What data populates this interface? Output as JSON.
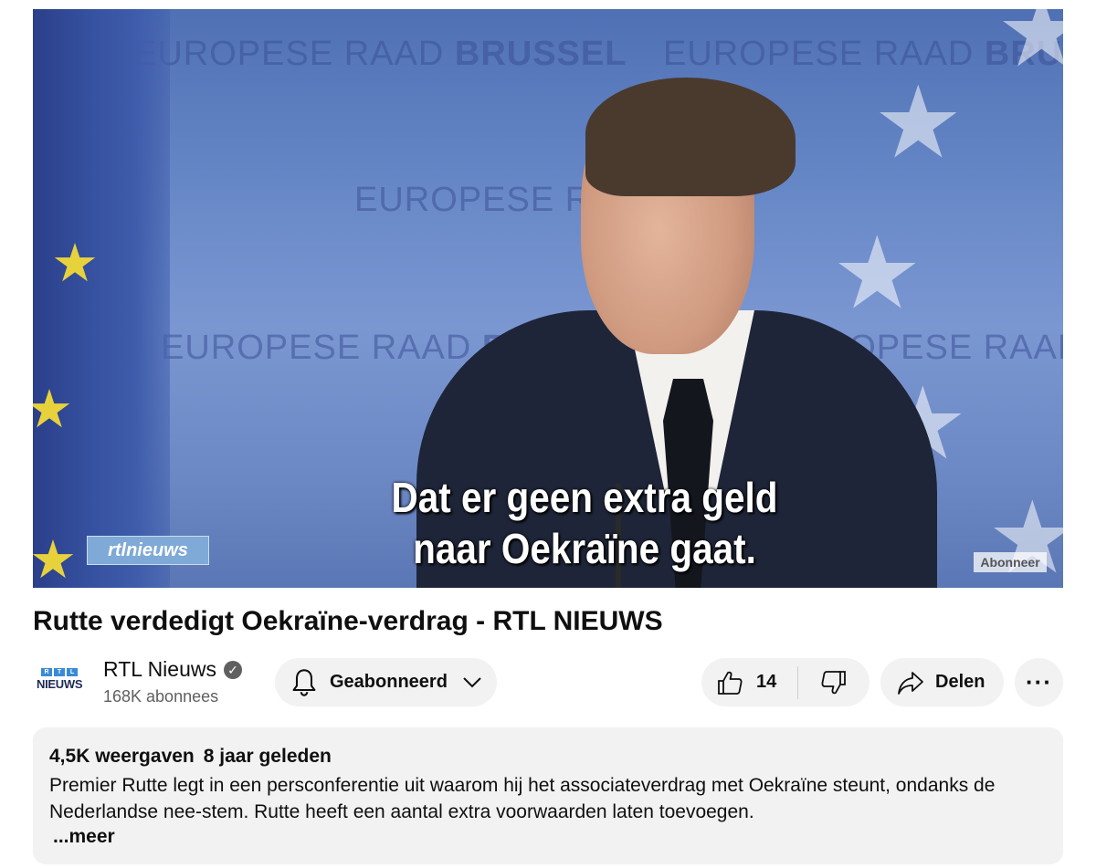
{
  "video": {
    "subtitle_line1": "Dat er geen extra geld",
    "subtitle_line2": "naar Oekraïne gaat.",
    "backdrop_text_regular": "EUROPESE RAAD",
    "backdrop_text_bold": "BRUSSEL",
    "overlay_logo": "rtlnieuws",
    "watermark": "Abonneer"
  },
  "title": "Rutte verdedigt Oekraïne-verdrag - RTL NIEUWS",
  "channel": {
    "logo_top": [
      "R",
      "T",
      "L"
    ],
    "logo_bottom": "NIEUWS",
    "name": "RTL Nieuws",
    "subscribers": "168K abonnees"
  },
  "actions": {
    "subscribe_label": "Geabonneerd",
    "like_count": "14",
    "share_label": "Delen",
    "more_label": "···"
  },
  "description": {
    "views": "4,5K weergaven",
    "age": "8 jaar geleden",
    "text": "Premier Rutte legt in een persconferentie uit waarom hij het associateverdrag met Oekraïne steunt, ondanks de Nederlandse nee-stem. Rutte heeft een aantal extra voorwaarden laten toevoegen.",
    "more_label": "...meer"
  }
}
